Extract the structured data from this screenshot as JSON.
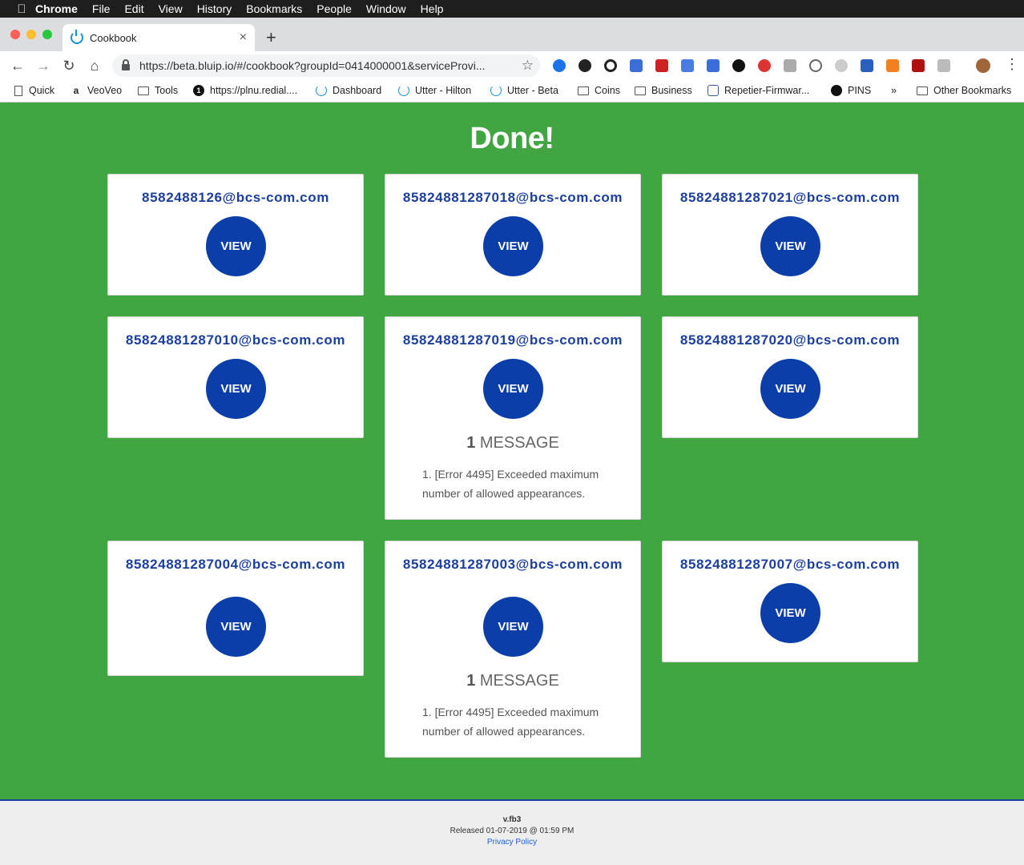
{
  "menubar": {
    "app": "Chrome",
    "items": [
      "File",
      "Edit",
      "View",
      "History",
      "Bookmarks",
      "People",
      "Window",
      "Help"
    ]
  },
  "tab": {
    "title": "Cookbook",
    "close": "×"
  },
  "toolbar": {
    "url": "https://beta.bluip.io/#/cookbook?groupId=0414000001&serviceProvi...",
    "new_tab": "+"
  },
  "bookmarks": [
    {
      "label": "Quick",
      "icon": "doc-icon"
    },
    {
      "label": "VeoVeo",
      "icon": "amazon-icon"
    },
    {
      "label": "Tools",
      "icon": "folder-icon"
    },
    {
      "label": "https://plnu.redial....",
      "icon": "one-icon"
    },
    {
      "label": "Dashboard",
      "icon": "power-icon"
    },
    {
      "label": "Utter - Hilton",
      "icon": "power-icon"
    },
    {
      "label": "Utter - Beta",
      "icon": "power-icon"
    },
    {
      "label": "Coins",
      "icon": "folder-icon"
    },
    {
      "label": "Business",
      "icon": "folder-icon"
    },
    {
      "label": "Repetier-Firmwar...",
      "icon": "shield-icon"
    },
    {
      "label": "PINS",
      "icon": "github-icon"
    },
    {
      "label": "»",
      "icon": ""
    },
    {
      "label": "Other Bookmarks",
      "icon": "folder-icon"
    }
  ],
  "heading": "Done!",
  "cards": [
    {
      "email": "8582488126@bcs-com.com",
      "button": "VIEW"
    },
    {
      "email": "85824881287018@bcs-com.com",
      "button": "VIEW"
    },
    {
      "email": "85824881287021@bcs-com.com",
      "button": "VIEW"
    },
    {
      "email": "85824881287010@bcs-com.com",
      "button": "VIEW"
    },
    {
      "email": "85824881287019@bcs-com.com",
      "button": "VIEW",
      "message_count": "1",
      "message_label": " MESSAGE",
      "messages": [
        "1. [Error 4495] Exceeded maximum number of allowed appearances."
      ]
    },
    {
      "email": "85824881287020@bcs-com.com",
      "button": "VIEW"
    },
    {
      "email": "85824881287004@bcs-com.com",
      "button": "VIEW"
    },
    {
      "email": "85824881287003@bcs-com.com",
      "button": "VIEW",
      "message_count": "1",
      "message_label": " MESSAGE",
      "messages": [
        "1. [Error 4495] Exceeded maximum number of allowed appearances."
      ]
    },
    {
      "email": "85824881287007@bcs-com.com",
      "button": "VIEW"
    }
  ],
  "footer": {
    "version": "v.fb3",
    "released": "Released 01-07-2019 @ 01:59 PM",
    "privacy": "Privacy Policy"
  },
  "colors": {
    "background": "#41a541",
    "accent": "#0b3ea8",
    "email_text": "#1c3f9e"
  }
}
